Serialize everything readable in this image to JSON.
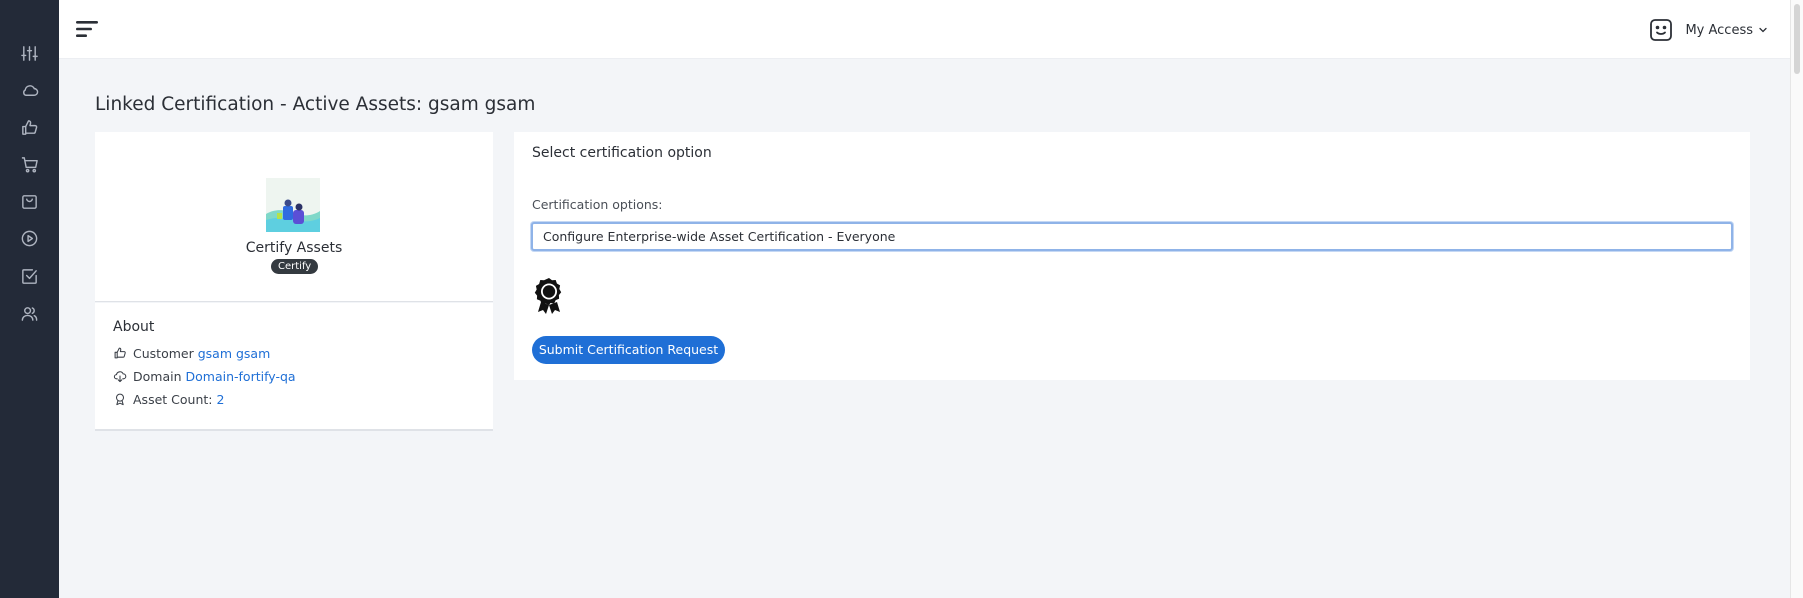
{
  "sidebar": {
    "items": [
      {
        "icon": "sliders-icon",
        "name": "sidebar-item-settings"
      },
      {
        "icon": "cloud-icon",
        "name": "sidebar-item-cloud"
      },
      {
        "icon": "thumbs-up-icon",
        "name": "sidebar-item-approvals"
      },
      {
        "icon": "cart-icon",
        "name": "sidebar-item-cart"
      },
      {
        "icon": "bag-icon",
        "name": "sidebar-item-bag"
      },
      {
        "icon": "play-icon",
        "name": "sidebar-item-play"
      },
      {
        "icon": "checkbox-icon",
        "name": "sidebar-item-tasks"
      },
      {
        "icon": "users-icon",
        "name": "sidebar-item-users"
      }
    ]
  },
  "header": {
    "menu_icon": "hamburger-menu-icon",
    "user_menu_label": "My Access",
    "user_icon": "smiley-icon"
  },
  "page": {
    "title": "Linked Certification - Active Assets: gsam gsam"
  },
  "app_card": {
    "name": "Certify Assets",
    "badge": "Certify"
  },
  "about": {
    "title": "About",
    "customer_label": "Customer",
    "customer_value": "gsam gsam",
    "domain_label": "Domain",
    "domain_value": "Domain-fortify-qa",
    "asset_count_label": "Asset Count:",
    "asset_count_value": "2"
  },
  "certification": {
    "section_title": "Select certification option",
    "options_label": "Certification options:",
    "selected_option": "Configure Enterprise-wide Asset Certification - Everyone",
    "submit_label": "Submit Certification Request"
  },
  "colors": {
    "sidebar_bg": "#232a38",
    "accent": "#1f6fd6",
    "badge_bg": "#343a40",
    "page_bg": "#f3f5f8"
  }
}
